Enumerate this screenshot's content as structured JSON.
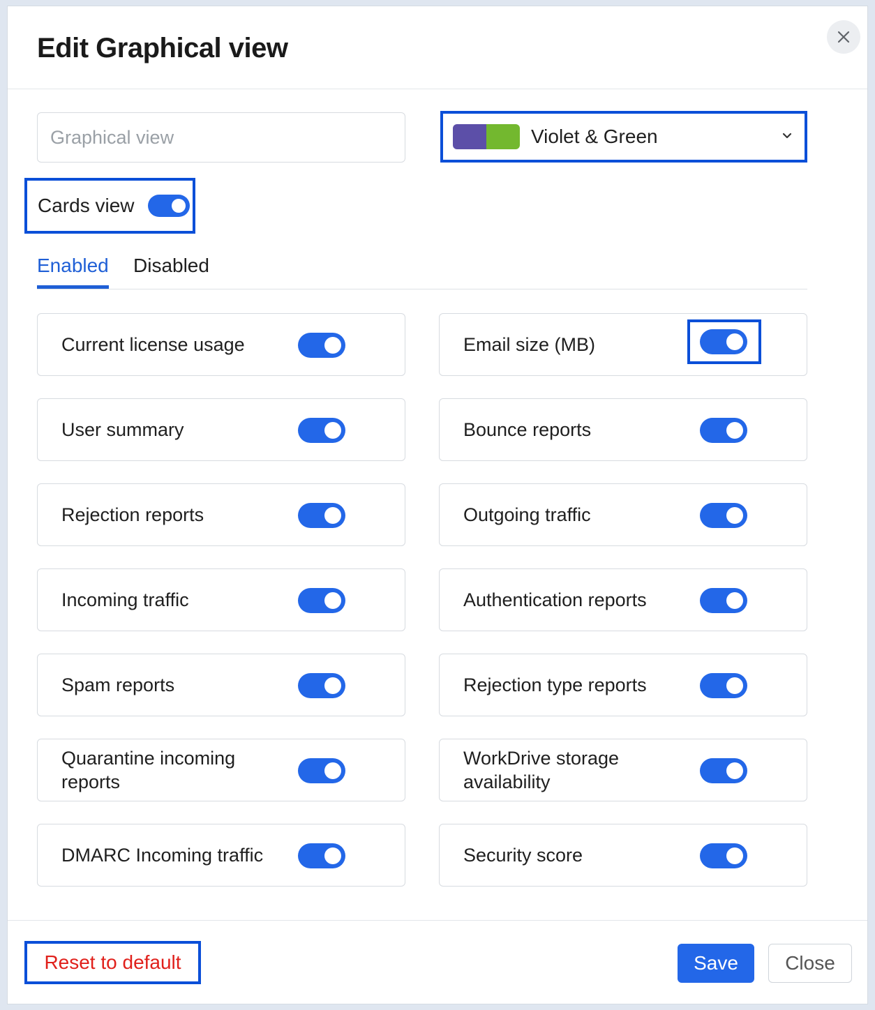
{
  "dialog": {
    "title": "Edit Graphical view",
    "close_icon": "close-icon"
  },
  "name_input": {
    "placeholder": "Graphical view",
    "value": ""
  },
  "theme": {
    "selected": "Violet & Green",
    "colors": [
      "#5c4fa8",
      "#73b82f"
    ],
    "chevron_icon": "chevron-down-icon"
  },
  "cards_view": {
    "label": "Cards view",
    "on": true
  },
  "tabs": [
    {
      "label": "Enabled",
      "active": true
    },
    {
      "label": "Disabled",
      "active": false
    }
  ],
  "cards": [
    {
      "label": "Current license usage",
      "on": true
    },
    {
      "label": "Email size (MB)",
      "on": true
    },
    {
      "label": "User summary",
      "on": true
    },
    {
      "label": "Bounce reports",
      "on": true
    },
    {
      "label": "Rejection reports",
      "on": true
    },
    {
      "label": "Outgoing traffic",
      "on": true
    },
    {
      "label": "Incoming traffic",
      "on": true
    },
    {
      "label": "Authentication reports",
      "on": true
    },
    {
      "label": "Spam reports",
      "on": true
    },
    {
      "label": "Rejection type reports",
      "on": true
    },
    {
      "label": "Quarantine incoming reports",
      "on": true
    },
    {
      "label": "WorkDrive storage availability",
      "on": true
    },
    {
      "label": "DMARC Incoming traffic",
      "on": true
    },
    {
      "label": "Security score",
      "on": true
    }
  ],
  "footer": {
    "reset_label": "Reset to default",
    "save_label": "Save",
    "close_label": "Close"
  },
  "colors": {
    "accent": "#2367e8",
    "highlight": "#0b4fd8",
    "danger": "#e0201b"
  }
}
